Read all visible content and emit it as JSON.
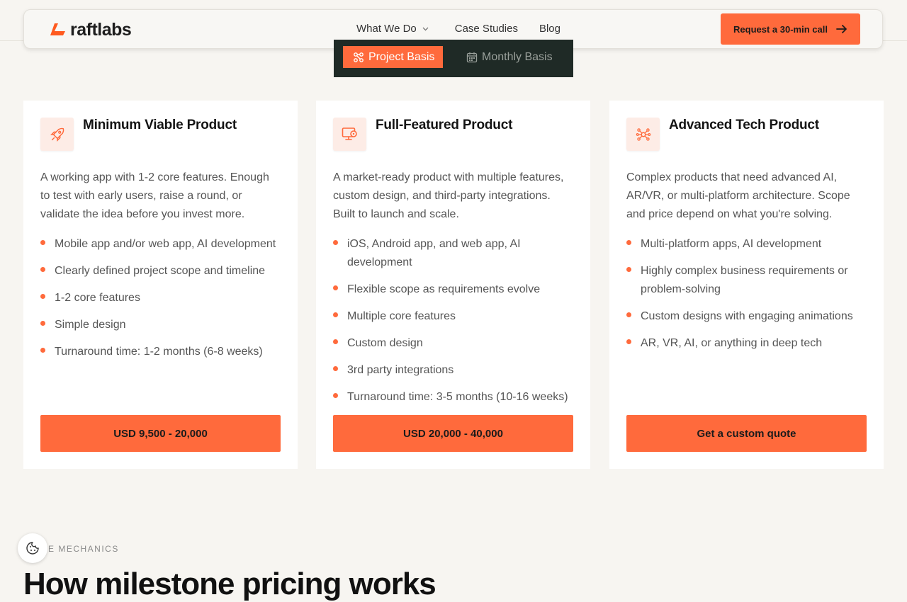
{
  "brand": {
    "name": "raftlabs",
    "accent": "#ff6a3c"
  },
  "nav": {
    "items": [
      {
        "label": "What We Do",
        "has_dropdown": true
      },
      {
        "label": "Case Studies"
      },
      {
        "label": "Blog"
      }
    ],
    "cta_label": "Request a 30-min call"
  },
  "pricing_toggle": {
    "options": [
      {
        "label": "Project Basis",
        "active": true,
        "icon": "nodes-icon"
      },
      {
        "label": "Monthly Basis",
        "active": false,
        "icon": "calendar-icon"
      }
    ]
  },
  "cards": [
    {
      "title": "Minimum Viable Product",
      "icon": "rocket-icon",
      "description": "A working app with 1-2 core features. Enough to test with early users, raise a round, or validate the idea before you invest more.",
      "features": [
        "Mobile app and/or web app, AI development",
        "Clearly defined project scope and timeline",
        "1-2 core features",
        "Simple design",
        "Turnaround time: 1-2 months (6-8 weeks)"
      ],
      "price_label": "USD 9,500 - 20,000"
    },
    {
      "title": "Full-Featured Product",
      "icon": "monitor-settings-icon",
      "description": "A market-ready product with multiple features, custom design, and third-party integrations. Built to launch and scale.",
      "features": [
        "iOS, Android app, and web app, AI development",
        "Flexible scope as requirements evolve",
        "Multiple core features",
        "Custom design",
        "3rd party integrations",
        "Turnaround time: 3-5 months (10-16 weeks)"
      ],
      "price_label": "USD 20,000 - 40,000"
    },
    {
      "title": "Advanced Tech Product",
      "icon": "network-icon",
      "description": "Complex products that need advanced AI, AR/VR, or multi-platform architecture. Scope and price depend on what you're solving.",
      "features": [
        "Multi-platform apps, AI development",
        "Highly complex business requirements or problem-solving",
        "Custom designs with engaging animations",
        "AR, VR, AI, or anything in deep tech"
      ],
      "price_label": "Get a custom quote"
    }
  ],
  "section": {
    "eyebrow": "E MECHANICS",
    "heading": "How milestone pricing works"
  }
}
